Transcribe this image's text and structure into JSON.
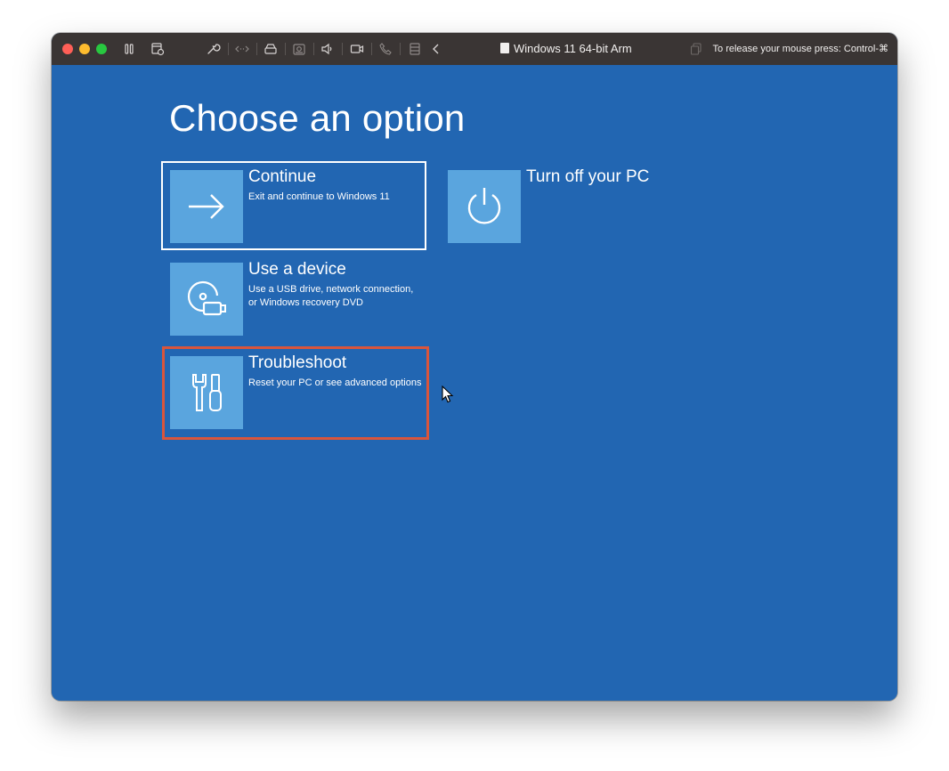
{
  "window": {
    "title": "Windows 11 64-bit Arm",
    "release_hint": "To release your mouse press: Control-⌘",
    "traffic_colors": {
      "close": "#ff5f57",
      "minimize": "#febc2e",
      "zoom": "#28c840"
    },
    "toolbar_icons": [
      "pause-icon",
      "snapshot-icon",
      "settings-wrench-icon",
      "code-arrows-icon",
      "hard-disk-icon",
      "camera-icon",
      "speaker-icon",
      "video-camera-icon",
      "phone-icon",
      "printer-icon",
      "chevron-left-icon"
    ]
  },
  "screen": {
    "background": "#2266b2",
    "tile_color": "#5aa5de",
    "heading": "Choose an option",
    "options": [
      {
        "title": "Continue",
        "description": "Exit and continue to Windows 11",
        "icon": "arrow-right-icon",
        "selected": true
      },
      {
        "title": "Turn off your PC",
        "description": "",
        "icon": "power-icon",
        "selected": false
      },
      {
        "title": "Use a device",
        "description": "Use a USB drive, network connection, or Windows recovery DVD",
        "icon": "usb-device-icon",
        "selected": false
      },
      {
        "title": "Troubleshoot",
        "description": "Reset your PC or see advanced options",
        "icon": "tools-icon",
        "selected": false
      }
    ],
    "annotation_color": "#d9553c"
  }
}
